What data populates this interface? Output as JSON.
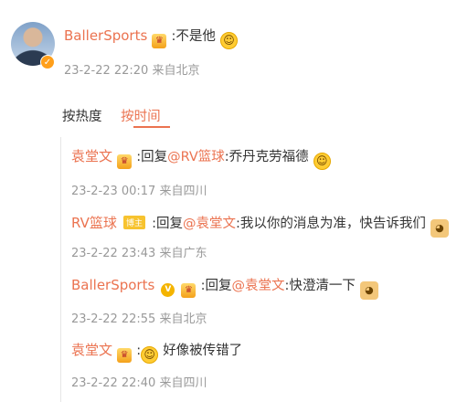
{
  "post": {
    "author": "BallerSports",
    "text": ":不是他",
    "time": "23-2-22 22:20",
    "source": "来自北京"
  },
  "sort": {
    "hot": "按热度",
    "time": "按时间"
  },
  "replies": [
    {
      "author": "袁堂文",
      "reply_prefix": ":回复",
      "mention": "@RV篮球",
      "text": ":乔丹克劳福德",
      "time": "23-2-23 00:17",
      "source": "来自四川"
    },
    {
      "author": "RV篮球",
      "badge": "博主",
      "reply_prefix": ":回复",
      "mention": "@袁堂文",
      "text": ":我以你的消息为准，快告诉我们",
      "time": "23-2-22 23:43",
      "source": "来自广东"
    },
    {
      "author": "BallerSports",
      "reply_prefix": ":回复",
      "mention": "@袁堂文",
      "text": ":快澄清一下",
      "time": "23-2-22 22:55",
      "source": "来自北京"
    },
    {
      "author": "袁堂文",
      "text": "好像被传错了",
      "colon": ":",
      "time": "23-2-22 22:40",
      "source": "来自四川"
    }
  ]
}
